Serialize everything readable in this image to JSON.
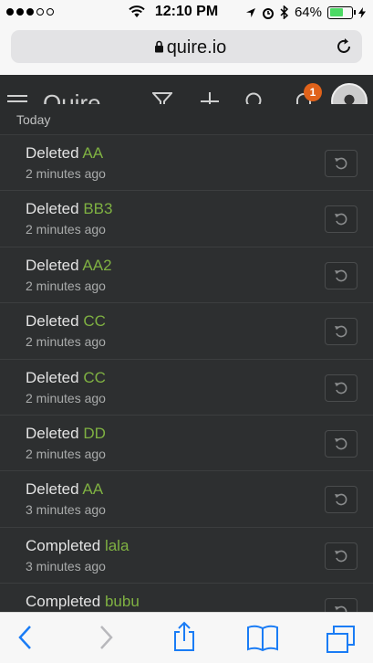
{
  "status_bar": {
    "time": "12:10 PM",
    "battery": "64%",
    "battery_level": 0.64
  },
  "browser": {
    "url": "quire.io"
  },
  "app": {
    "logo": "Quire",
    "notification_count": "1"
  },
  "activity": {
    "section": "Today",
    "items": [
      {
        "action": "Deleted",
        "target": "AA",
        "time": "2 minutes ago"
      },
      {
        "action": "Deleted",
        "target": "BB3",
        "time": "2 minutes ago"
      },
      {
        "action": "Deleted",
        "target": "AA2",
        "time": "2 minutes ago"
      },
      {
        "action": "Deleted",
        "target": "CC",
        "time": "2 minutes ago"
      },
      {
        "action": "Deleted",
        "target": "CC",
        "time": "2 minutes ago"
      },
      {
        "action": "Deleted",
        "target": "DD",
        "time": "2 minutes ago"
      },
      {
        "action": "Deleted",
        "target": "AA",
        "time": "3 minutes ago"
      },
      {
        "action": "Completed",
        "target": "lala",
        "time": "3 minutes ago"
      },
      {
        "action": "Completed",
        "target": "bubu",
        "time": ""
      }
    ]
  },
  "icons": {
    "header": [
      "hamburger-icon",
      "filter-icon",
      "add-icon",
      "search-icon",
      "bell-icon"
    ],
    "row": "undo-icon",
    "toolbar": [
      "back-icon",
      "forward-icon",
      "share-icon",
      "bookmarks-icon",
      "tabs-icon"
    ]
  },
  "colors": {
    "accent_link": "#7fb142",
    "badge": "#e0621a",
    "ios_blue": "#1a7cf5"
  }
}
